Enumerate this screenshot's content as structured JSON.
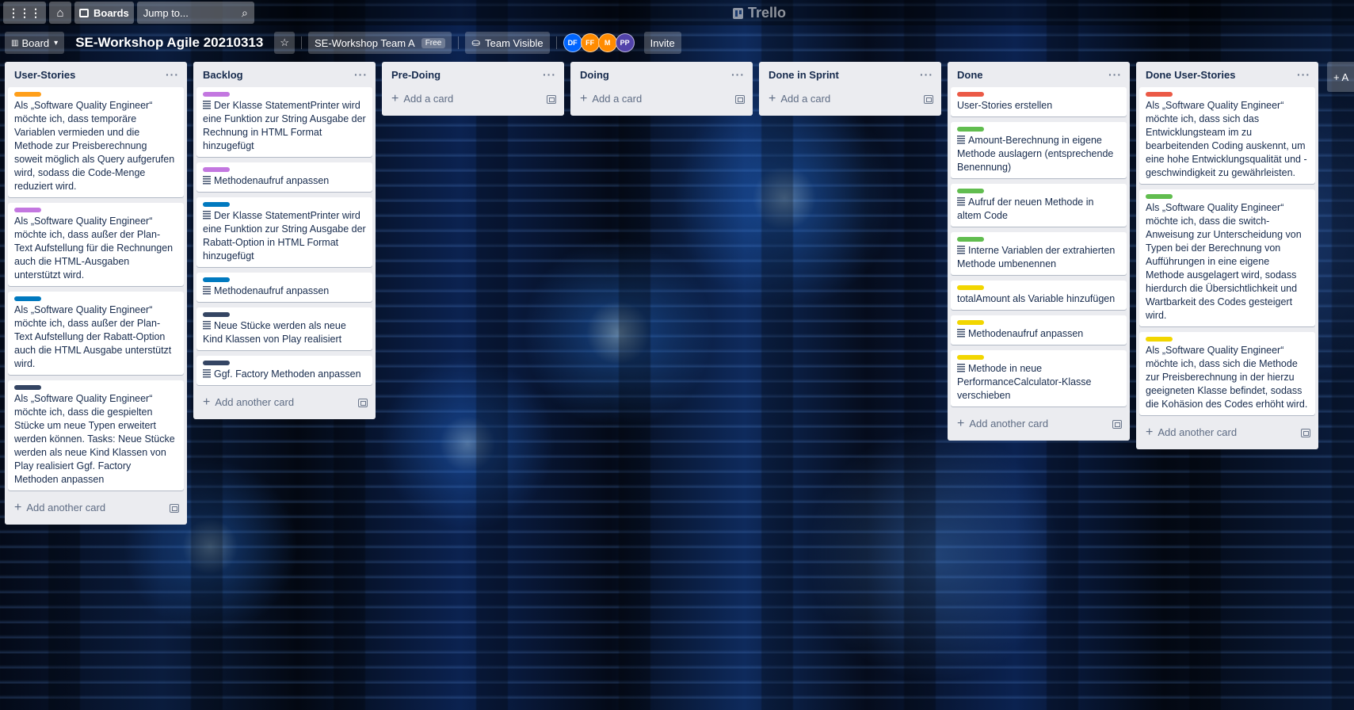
{
  "topnav": {
    "boards_label": "Boards",
    "search_placeholder": "Jump to...",
    "logo_text": "Trello"
  },
  "header": {
    "view_label": "Board",
    "board_title": "SE-Workshop Agile 20210313",
    "team_label": "SE-Workshop Team A",
    "team_badge": "Free",
    "visibility_label": "Team Visible",
    "members": [
      {
        "initials": "DF",
        "color": "#0065ff"
      },
      {
        "initials": "FF",
        "color": "#ff8b00"
      },
      {
        "initials": "M",
        "color": "#ff8b00"
      },
      {
        "initials": "PP",
        "color": "#5243aa"
      }
    ],
    "invite_label": "Invite"
  },
  "colors": {
    "orange": "#ff9f1a",
    "purple": "#c377e0",
    "blue": "#0079bf",
    "black": "#344563",
    "red": "#eb5a46",
    "green": "#61bd4f",
    "yellow": "#f2d600"
  },
  "lists": [
    {
      "title": "User-Stories",
      "add_label": "Add another card",
      "cards": [
        {
          "label": "#ff9f1a",
          "desc": false,
          "text": "Als „Software Quality Engineer“ möchte ich, dass temporäre Variablen vermieden und die Methode zur Preisberechnung soweit möglich als Query aufgerufen wird, sodass die Code-Menge reduziert wird."
        },
        {
          "label": "#c377e0",
          "desc": false,
          "text": "Als „Software Quality Engineer“ möchte ich, dass außer der Plan-Text Aufstellung für die Rechnungen auch die HTML-Ausgaben unterstützt wird."
        },
        {
          "label": "#0079bf",
          "desc": false,
          "text": "Als „Software Quality Engineer“ möchte ich, dass außer der Plan-Text Aufstellung der Rabatt-Option auch die HTML Ausgabe unterstützt wird."
        },
        {
          "label": "#344563",
          "desc": false,
          "text": "Als „Software Quality Engineer“ möchte ich, dass die gespielten Stücke um neue Typen erweitert werden können. Tasks: Neue Stücke werden als neue Kind Klassen von Play realisiert Ggf. Factory Methoden anpassen"
        }
      ]
    },
    {
      "title": "Backlog",
      "add_label": "Add another card",
      "cards": [
        {
          "label": "#c377e0",
          "desc": true,
          "text": "Der Klasse StatementPrinter wird eine Funktion zur String Ausgabe der Rechnung in HTML Format hinzugefügt"
        },
        {
          "label": "#c377e0",
          "desc": true,
          "text": "Methodenaufruf anpassen"
        },
        {
          "label": "#0079bf",
          "desc": true,
          "text": "Der Klasse StatementPrinter wird eine Funktion zur String Ausgabe der Rabatt-Option in HTML Format hinzugefügt"
        },
        {
          "label": "#0079bf",
          "desc": true,
          "text": "Methodenaufruf anpassen"
        },
        {
          "label": "#344563",
          "desc": true,
          "text": "Neue Stücke werden als neue Kind Klassen von Play realisiert"
        },
        {
          "label": "#344563",
          "desc": true,
          "text": "Ggf. Factory Methoden anpassen"
        }
      ]
    },
    {
      "title": "Pre-Doing",
      "add_label": "Add a card",
      "cards": []
    },
    {
      "title": "Doing",
      "add_label": "Add a card",
      "cards": []
    },
    {
      "title": "Done in Sprint",
      "add_label": "Add a card",
      "cards": []
    },
    {
      "title": "Done",
      "add_label": "Add another card",
      "cards": [
        {
          "label": "#eb5a46",
          "desc": false,
          "text": "User-Stories erstellen"
        },
        {
          "label": "#61bd4f",
          "desc": true,
          "text": "Amount-Berechnung in eigene Methode auslagern (entsprechende Benennung)"
        },
        {
          "label": "#61bd4f",
          "desc": true,
          "text": "Aufruf der neuen Methode in altem Code"
        },
        {
          "label": "#61bd4f",
          "desc": true,
          "text": "Interne Variablen der extrahierten Methode umbenennen"
        },
        {
          "label": "#f2d600",
          "desc": false,
          "text": "totalAmount als Variable hinzufügen"
        },
        {
          "label": "#f2d600",
          "desc": true,
          "text": "Methodenaufruf anpassen"
        },
        {
          "label": "#f2d600",
          "desc": true,
          "text": "Methode in neue PerformanceCalculator-Klasse verschieben"
        }
      ]
    },
    {
      "title": "Done User-Stories",
      "add_label": "Add another card",
      "cards": [
        {
          "label": "#eb5a46",
          "desc": false,
          "text": "Als „Software Quality Engineer“ möchte ich, dass sich das Entwicklungsteam im zu bearbeitenden Coding auskennt, um eine hohe Entwicklungsqualität und -geschwindigkeit zu gewährleisten."
        },
        {
          "label": "#61bd4f",
          "desc": false,
          "text": "Als „Software Quality Engineer“ möchte ich, dass die switch-Anweisung zur Unterscheidung von Typen bei der Berechnung von Aufführungen in eine eigene Methode ausgelagert wird, sodass hierdurch die Übersichtlichkeit und Wartbarkeit des Codes gesteigert wird."
        },
        {
          "label": "#f2d600",
          "desc": false,
          "text": "Als „Software Quality Engineer“ möchte ich, dass sich die Methode zur Preisberechnung in der hierzu geeigneten Klasse befindet, sodass die Kohäsion des Codes erhöht wird."
        }
      ]
    }
  ],
  "add_list_label": "+ A"
}
